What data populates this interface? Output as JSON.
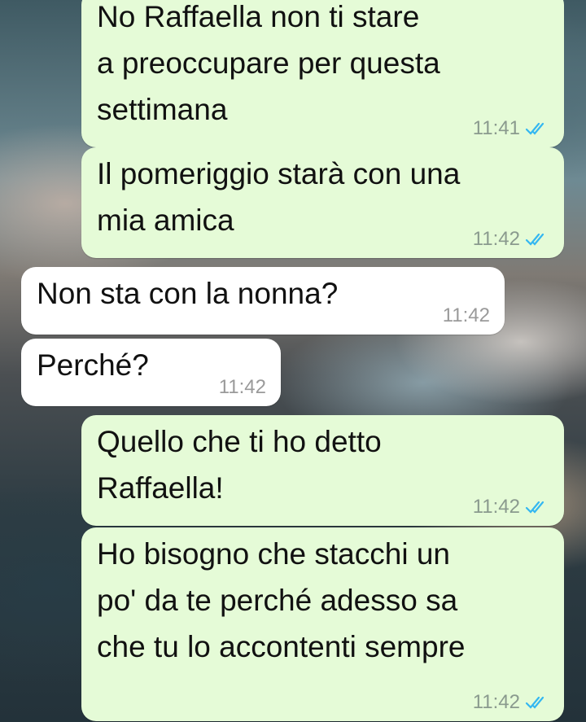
{
  "wallpaper": "background-image",
  "colors": {
    "outgoing_bubble": "#e5fbd7",
    "incoming_bubble": "#ffffff",
    "read_ticks": "#34b7f1"
  },
  "messages": [
    {
      "direction": "outgoing",
      "text": "No Raffaella non ti stare\na preoccupare per questa\nsettimana",
      "time": "11:41",
      "status": "read",
      "status_icon": "double-check-icon"
    },
    {
      "direction": "outgoing",
      "text": "Il pomeriggio starà con una\nmia amica",
      "time": "11:42",
      "status": "read",
      "status_icon": "double-check-icon"
    },
    {
      "direction": "incoming",
      "text": "Non sta con la nonna?",
      "time": "11:42"
    },
    {
      "direction": "incoming",
      "text": "Perché?",
      "time": "11:42"
    },
    {
      "direction": "outgoing",
      "text": "Quello che ti ho detto\nRaffaella!",
      "time": "11:42",
      "status": "read",
      "status_icon": "double-check-icon"
    },
    {
      "direction": "outgoing",
      "text": "Ho bisogno che stacchi un\npo' da te perché adesso sa\nche tu lo accontenti sempre",
      "time": "11:42",
      "status": "read",
      "status_icon": "double-check-icon"
    }
  ]
}
